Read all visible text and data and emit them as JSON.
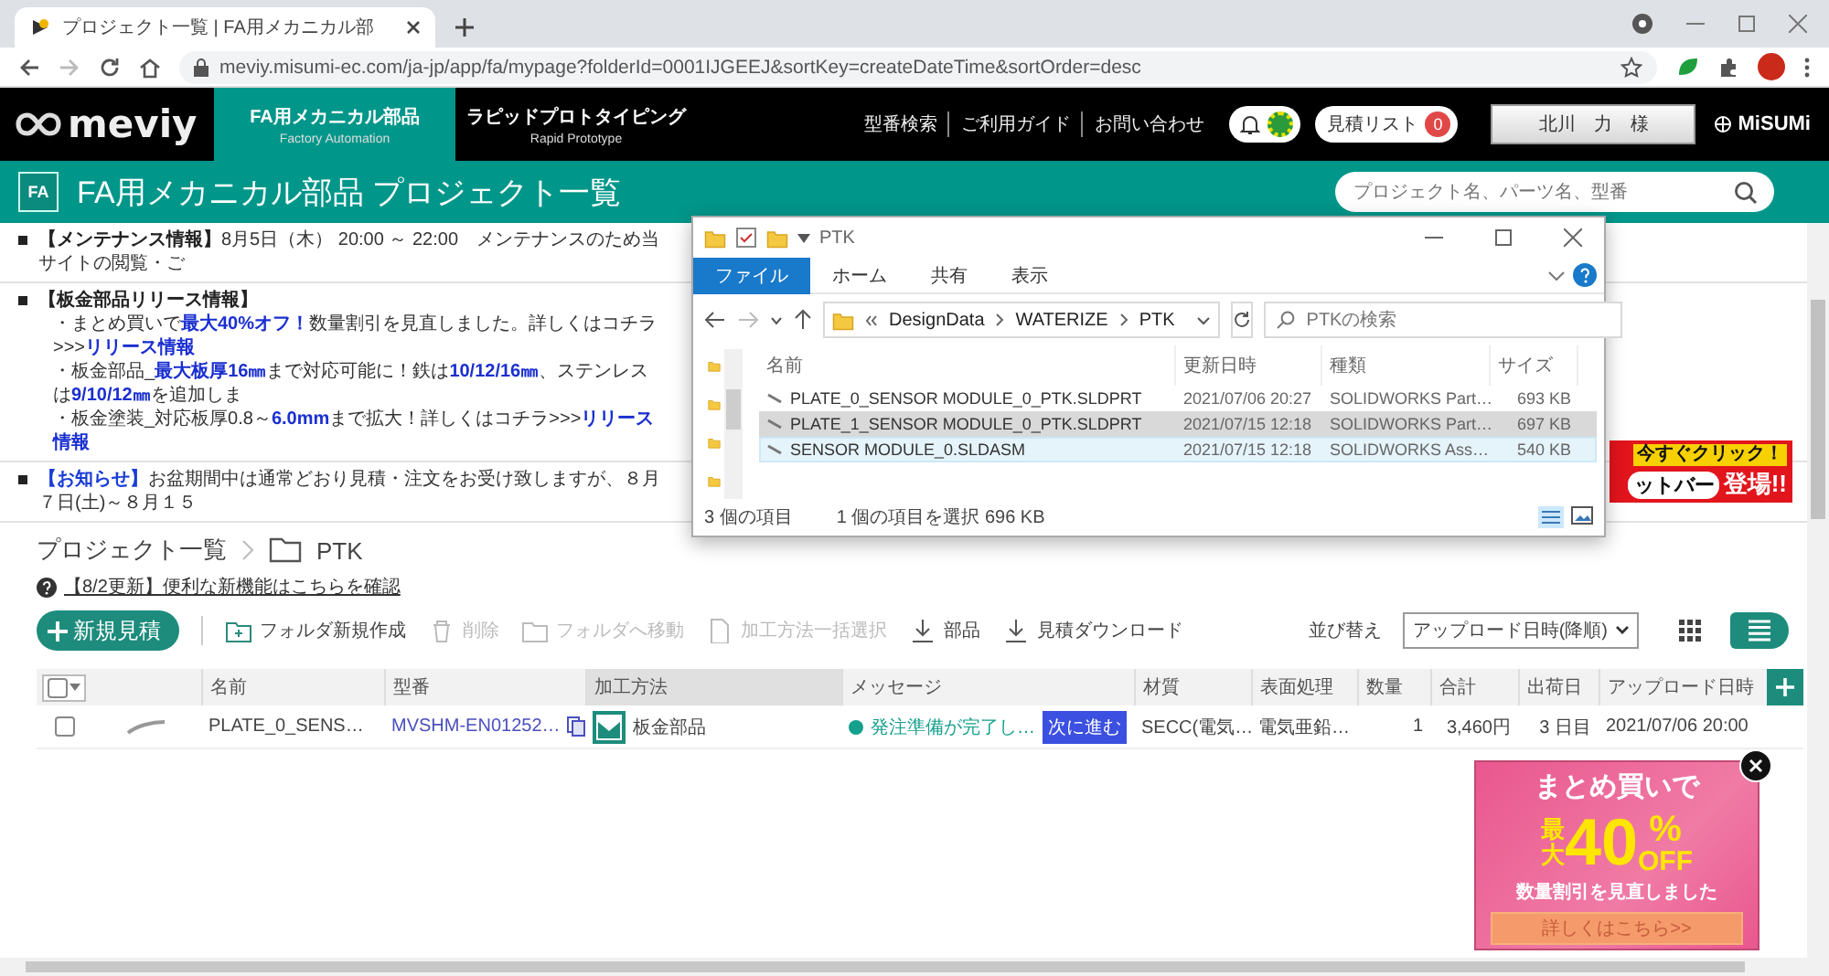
{
  "browser": {
    "tab": "プロジェクト一覧 | FA用メカニカル部",
    "url": "meviy.misumi-ec.com/ja-jp/app/fa/mypage?folderId=0001IJGEEJ&sortKey=createDateTime&sortOrder=desc"
  },
  "header": {
    "logo": "meviy",
    "nav": [
      {
        "label": "FA用メカニカル部品",
        "sub": "Factory Automation",
        "selected": true
      },
      {
        "label": "ラピッドプロトタイピング",
        "sub": "Rapid Prototype",
        "selected": false
      }
    ],
    "links": [
      "型番検索",
      "ご利用ガイド",
      "お問い合わせ"
    ],
    "quote_list": {
      "label": "見積リスト",
      "count": "0"
    },
    "user": "北川　力　様",
    "brand": "MiSUMi"
  },
  "page_title": {
    "badge": "FA",
    "title": "FA用メカニカル部品 プロジェクト一覧",
    "search": {
      "placeholder": "プロジェクト名、パーツ名、型番"
    }
  },
  "notices": [
    {
      "color": "#222222",
      "heading": "【メンテナンス情報】",
      "text": "8月5日（木） 20:00 ～ 22:00　メンテナンスのため当サイトの閲覧・ご"
    },
    {
      "color": "#222222",
      "heading": "【板金部品リリース情報】",
      "lines": [
        "・まとめ買いで**最大40%オフ！**数量割引を見直しました。詳しくはコチラ>>>**リリース情報**",
        "・板金部品_**最大板厚16㎜**まで対応可能に！鉄は**10/12/16㎜**、ステンレスは**9/10/12㎜**を追加しま",
        "・板金塗装_対応板厚0.8～**6.0mm**まで拡大！詳しくはコチラ>>>**リリース情報**"
      ]
    },
    {
      "color": "#1a3dd6",
      "heading": "【お知らせ】",
      "text": "お盆期間中は通常どおり見積・注文をお受け致しますが、８月７日(土)～８月１５"
    }
  ],
  "breadcrumb": [
    {
      "kind": "link",
      "label": "プロジェクト一覧"
    },
    {
      "kind": "folder",
      "label": "PTK"
    }
  ],
  "help_link": "【8/2更新】便利な新機能はこちらを確認",
  "toolbar": {
    "new_button": "新規見積",
    "actions": [
      {
        "kind": "folder-add",
        "label": "フォルダ新規作成",
        "disabled": false
      },
      {
        "kind": "trash",
        "label": "削除",
        "disabled": true
      },
      {
        "kind": "folder-move",
        "label": "フォルダへ移動",
        "disabled": true
      },
      {
        "kind": "process",
        "label": "加工方法一括選択",
        "disabled": true
      },
      {
        "kind": "download",
        "label": "部品",
        "disabled": false
      },
      {
        "kind": "download",
        "label": "見積ダウンロード",
        "disabled": false
      }
    ],
    "sort_label": "並び替え",
    "sort_value": "アップロード日時(降順)",
    "views": [
      {
        "kind": "grid",
        "selected": false
      },
      {
        "kind": "list",
        "selected": true
      }
    ]
  },
  "table": {
    "select_all_checked": false,
    "columns": [
      {
        "label": "名前",
        "highlighted": false
      },
      {
        "label": "型番",
        "highlighted": false
      },
      {
        "label": "加工方法",
        "highlighted": true
      },
      {
        "label": "メッセージ",
        "highlighted": false
      },
      {
        "label": "材質",
        "highlighted": false
      },
      {
        "label": "表面処理",
        "highlighted": false
      },
      {
        "label": "数量",
        "highlighted": false
      },
      {
        "label": "合計",
        "highlighted": false
      },
      {
        "label": "出荷日",
        "highlighted": false
      },
      {
        "label": "アップロード日時",
        "highlighted": false
      }
    ],
    "rows": [
      {
        "checked": false,
        "name": "PLATE_0_SENS…",
        "part_number": "MVSHM-EN01252…",
        "process": "板金部品",
        "color": "#14a08c",
        "status": "発注準備が完了し…",
        "action": "次に進む",
        "material": "SECC(電気…",
        "finish": "電気亜鉛…",
        "quantity": "1",
        "total": "3,460円",
        "ship_day": "3 日目",
        "uploaded": "2021/07/06 20:00"
      }
    ]
  },
  "banner": {
    "tag": "今すぐクリック！",
    "title": "ットバー",
    "suffix": "登場!!"
  },
  "popup": {
    "line1": "まとめ買いで",
    "prefix": "最大",
    "number": "40",
    "unit": "%",
    "off": "OFF",
    "subtitle": "数量割引を見直しました",
    "button": "詳しくはこちら>>"
  },
  "explorer": {
    "title": "PTK",
    "ribbon": [
      {
        "label": "ファイル",
        "selected": true
      },
      {
        "label": "ホーム",
        "selected": false
      },
      {
        "label": "共有",
        "selected": false
      },
      {
        "label": "表示",
        "selected": false
      }
    ],
    "path": [
      "DesignData",
      "WATERIZE",
      "PTK"
    ],
    "search": {
      "placeholder": "PTKの検索"
    },
    "columns": [
      "名前",
      "更新日時",
      "種類",
      "サイズ"
    ],
    "files": [
      {
        "name": "PLATE_0_SENSOR MODULE_0_PTK.SLDPRT",
        "modified": "2021/07/06 20:27",
        "type": "SOLIDWORKS Part…",
        "size": "693 KB",
        "selected": false,
        "hovered": false
      },
      {
        "name": "PLATE_1_SENSOR MODULE_0_PTK.SLDPRT",
        "modified": "2021/07/15 12:18",
        "type": "SOLIDWORKS Part…",
        "size": "697 KB",
        "selected": true,
        "hovered": false
      },
      {
        "name": "SENSOR MODULE_0.SLDASM",
        "modified": "2021/07/15 12:18",
        "type": "SOLIDWORKS Ass…",
        "size": "540 KB",
        "selected": false,
        "hovered": true
      }
    ],
    "status": {
      "count": "3 個の項目",
      "selection": "1 個の項目を選択  696 KB"
    }
  }
}
